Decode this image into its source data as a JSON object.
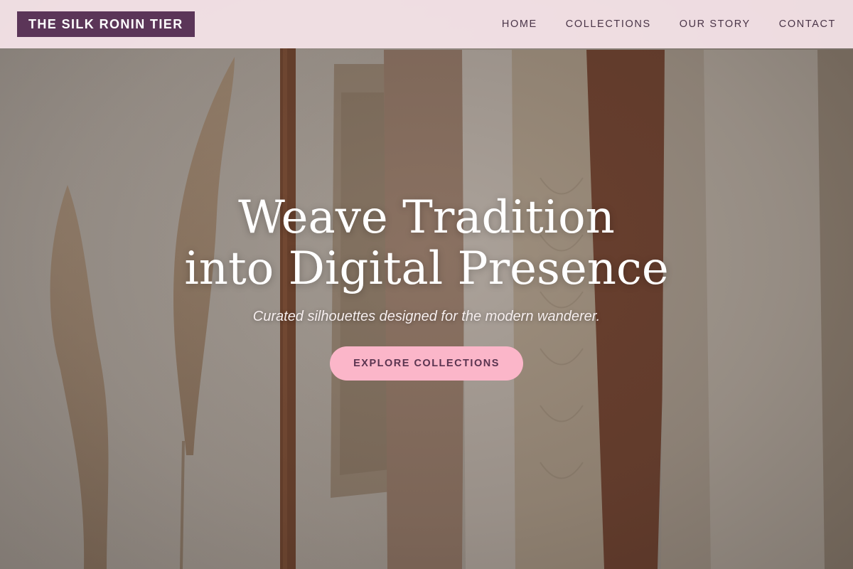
{
  "header": {
    "logo_text": "THE SILK RONIN TIER",
    "nav": [
      {
        "label": "HOME"
      },
      {
        "label": "COLLECTIONS"
      },
      {
        "label": "OUR STORY"
      },
      {
        "label": "CONTACT"
      }
    ]
  },
  "hero": {
    "title_line1": "Weave Tradition",
    "title_line2": "into Digital Presence",
    "subtitle": "Curated silhouettes designed for the modern wanderer.",
    "cta_label": "EXPLORE COLLECTIONS"
  },
  "colors": {
    "header_bg": "#f6e4ea",
    "logo_bg": "#5b3558",
    "nav_text": "#4a3548",
    "cta_bg": "#fbb6c9",
    "cta_text": "#5a3450"
  }
}
